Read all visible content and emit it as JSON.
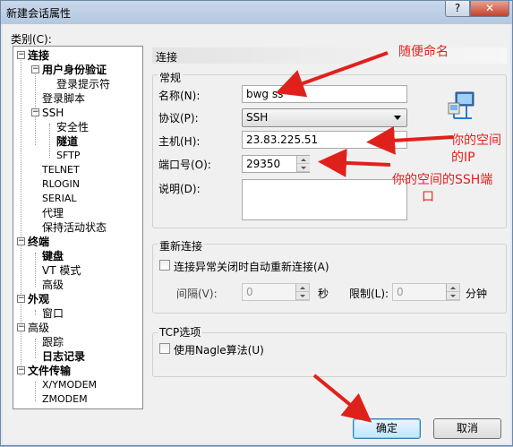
{
  "window": {
    "title": "新建会话属性",
    "help_glyph": "?",
    "close_glyph": "✕"
  },
  "category_label": "类别(C):",
  "tree": [
    {
      "label": "连接",
      "bold": true
    },
    {
      "label": "用户身份验证",
      "bold": true
    },
    {
      "label": "登录提示符",
      "bold": false
    },
    {
      "label": "登录脚本",
      "bold": false
    },
    {
      "label": "SSH",
      "bold": false
    },
    {
      "label": "安全性",
      "bold": false
    },
    {
      "label": "隧道",
      "bold": true
    },
    {
      "label": "SFTP",
      "bold": false
    },
    {
      "label": "TELNET",
      "bold": false
    },
    {
      "label": "RLOGIN",
      "bold": false
    },
    {
      "label": "SERIAL",
      "bold": false
    },
    {
      "label": "代理",
      "bold": false
    },
    {
      "label": "保持活动状态",
      "bold": false
    },
    {
      "label": "终端",
      "bold": true
    },
    {
      "label": "键盘",
      "bold": true
    },
    {
      "label": "VT 模式",
      "bold": false
    },
    {
      "label": "高级",
      "bold": false
    },
    {
      "label": "外观",
      "bold": true
    },
    {
      "label": "窗口",
      "bold": false
    },
    {
      "label": "高级",
      "bold": false
    },
    {
      "label": "跟踪",
      "bold": false
    },
    {
      "label": "日志记录",
      "bold": true
    },
    {
      "label": "文件传输",
      "bold": true
    },
    {
      "label": "X/YMODEM",
      "bold": false
    },
    {
      "label": "ZMODEM",
      "bold": false
    }
  ],
  "section_title": "连接",
  "general": {
    "title": "常规",
    "name_label": "名称(N):",
    "name_value": "bwg ss",
    "protocol_label": "协议(P):",
    "protocol_value": "SSH",
    "host_label": "主机(H):",
    "host_value": "23.83.225.51",
    "port_label": "端口号(O):",
    "port_value": "29350",
    "desc_label": "说明(D):",
    "desc_value": ""
  },
  "reconnect": {
    "title": "重新连接",
    "auto_label": "连接异常关闭时自动重新连接(A)",
    "auto_checked": false,
    "interval_label": "间隔(V):",
    "interval_value": "0",
    "seconds_unit": "秒",
    "limit_label": "限制(L):",
    "limit_value": "0",
    "minutes_unit": "分钟"
  },
  "tcp": {
    "title": "TCP选项",
    "nagle_label": "使用Nagle算法(U)",
    "nagle_checked": false
  },
  "buttons": {
    "ok": "确定",
    "cancel": "取消"
  },
  "annotations": {
    "name_note": "随便命名",
    "ip_note_1": "你的空间",
    "ip_note_2": "的IP",
    "port_note_1": "你的空间的SSH端",
    "port_note_2": "口"
  },
  "colors": {
    "annotation_red": "#e0211b",
    "default_button": "#bee6fd"
  }
}
